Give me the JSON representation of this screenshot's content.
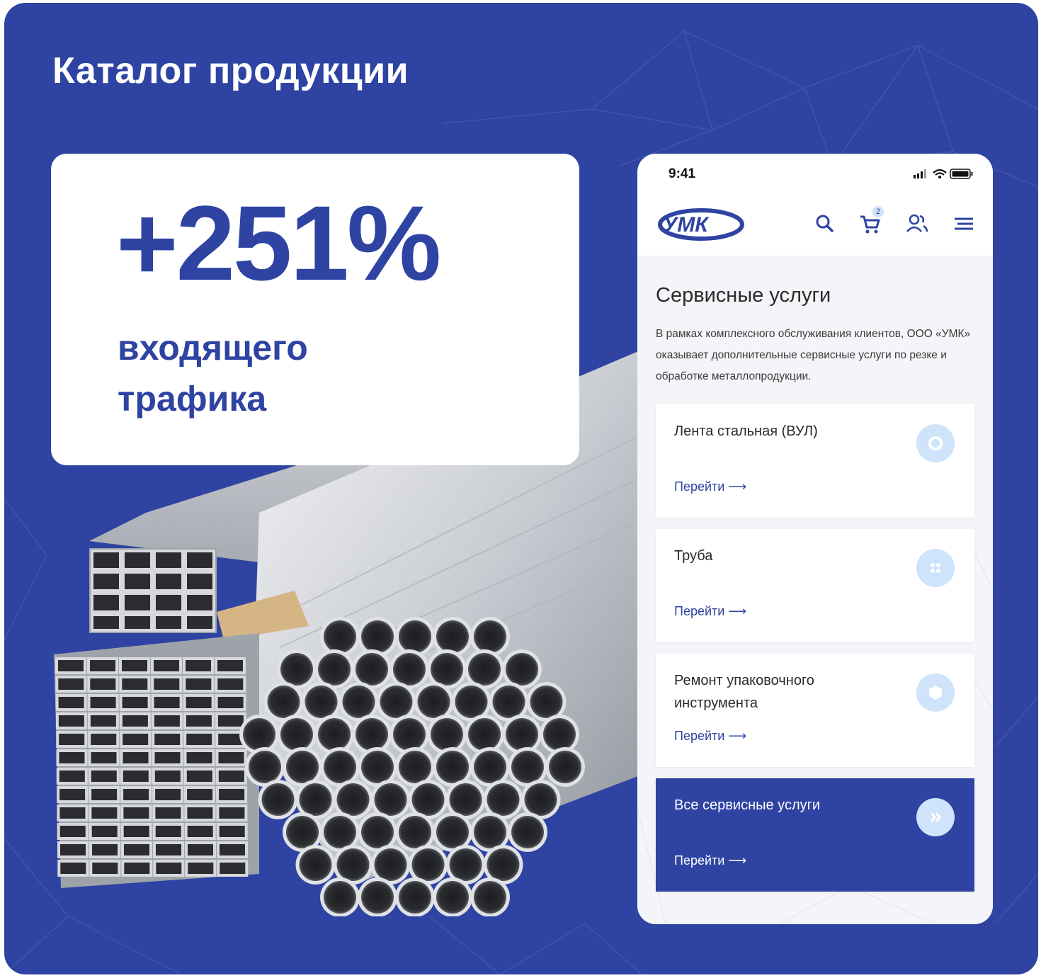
{
  "banner": {
    "title": "Каталог продукции",
    "stat_value": "+251%",
    "stat_caption": "входящего\nтрафика"
  },
  "phone": {
    "status_time": "9:41",
    "logo_text": "УМК",
    "cart_count": "2",
    "section_title": "Сервисные услуги",
    "section_description": "В рамках комплексного обслуживания клиентов, ООО «УМК» оказывает дополнительные сервисные услуги по резке и обработке металлопродукции.",
    "services": [
      {
        "name": "Лента стальная (ВУЛ)",
        "link": "Перейти ⟶",
        "icon": "ring-icon"
      },
      {
        "name": "Труба",
        "link": "Перейти ⟶",
        "icon": "grid-dots-icon"
      },
      {
        "name": "Ремонт упаковочного инструмента",
        "link": "Перейти ⟶",
        "icon": "cube-icon"
      },
      {
        "name": "Все сервисные услуги",
        "link": "Перейти ⟶",
        "icon": "double-chevron-icon"
      }
    ]
  },
  "colors": {
    "brand_blue": "#2e43a2",
    "light_blue": "#cfe3fb",
    "card_bg": "#ffffff"
  }
}
